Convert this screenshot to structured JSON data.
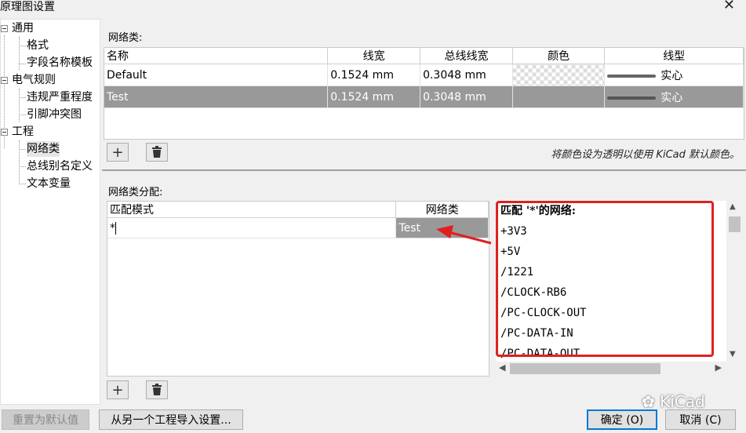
{
  "window": {
    "title": "原理图设置"
  },
  "tree": {
    "items": [
      {
        "label": "通用"
      },
      {
        "label": "格式"
      },
      {
        "label": "字段名称模板"
      },
      {
        "label": "电气规则"
      },
      {
        "label": "违规严重程度"
      },
      {
        "label": "引脚冲突图"
      },
      {
        "label": "工程"
      },
      {
        "label": "网络类"
      },
      {
        "label": "总线别名定义"
      },
      {
        "label": "文本变量"
      }
    ]
  },
  "net_classes": {
    "section_label": "网络类:",
    "columns": [
      "名称",
      "线宽",
      "总线线宽",
      "颜色",
      "线型"
    ],
    "rows": [
      {
        "name": "Default",
        "wire_width": "0.1524 mm",
        "bus_width": "0.3048 mm",
        "line_style": "实心"
      },
      {
        "name": "Test",
        "wire_width": "0.1524 mm",
        "bus_width": "0.3048 mm",
        "line_style": "实心"
      }
    ],
    "hint": "将颜色设为透明以使用 KiCad 默认颜色。"
  },
  "assignments": {
    "section_label": "网络类分配:",
    "columns": [
      "匹配模式",
      "网络类"
    ],
    "rows": [
      {
        "pattern": "*",
        "net_class": "Test"
      }
    ]
  },
  "matched_nets": {
    "header": "匹配 '*'的网络:",
    "items": [
      "+3V3",
      "+5V",
      "/1221",
      "/CLOCK-RB6",
      "/PC-CLOCK-OUT",
      "/PC-DATA-IN",
      "/PC-DATA-OUT"
    ]
  },
  "buttons": {
    "reset": "重置为默认值",
    "import": "从另一个工程导入设置...",
    "ok": "确定 (O)",
    "cancel": "取消 (C)"
  },
  "watermark": "KiCad",
  "colors": {
    "selection": "#999999",
    "annotation_red": "#e02020",
    "default_button_border": "#0078d7"
  }
}
